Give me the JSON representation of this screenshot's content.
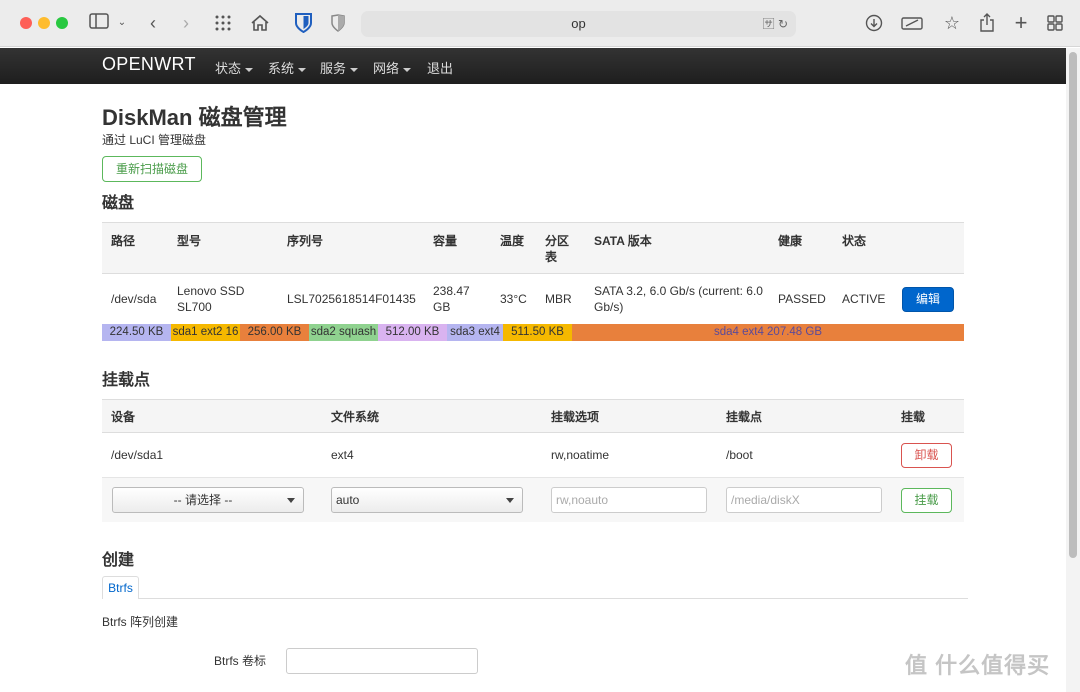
{
  "browser": {
    "address": "op"
  },
  "navbar": {
    "brand": "OPENWRT",
    "items": [
      "状态",
      "系统",
      "服务",
      "网络",
      "退出"
    ]
  },
  "page": {
    "title": "DiskMan 磁盘管理",
    "subtitle": "通过 LuCI 管理磁盘",
    "rescan_label": "重新扫描磁盘"
  },
  "disks": {
    "heading": "磁盘",
    "headers": {
      "path": "路径",
      "model": "型号",
      "serial": "序列号",
      "size": "容量",
      "temp": "温度",
      "ptable": "分区表",
      "sata": "SATA 版本",
      "health": "健康",
      "status": "状态"
    },
    "row": {
      "path": "/dev/sda",
      "model": "Lenovo SSD SL700",
      "serial": "LSL7025618514F01435",
      "size": "238.47 GB",
      "temp": "33°C",
      "ptable": "MBR",
      "sata": "SATA 3.2, 6.0 Gb/s (current: 6.0 Gb/s)",
      "health": "PASSED",
      "status": "ACTIVE",
      "edit_label": "编辑"
    },
    "partitions": [
      {
        "label": "224.50 KB",
        "color": "#b5b5f0"
      },
      {
        "label": "sda1 ext2 16",
        "color": "#f5b800"
      },
      {
        "label": "256.00 KB",
        "color": "#e8803c"
      },
      {
        "label": "sda2 squash",
        "color": "#8fd28f"
      },
      {
        "label": "512.00 KB",
        "color": "#d9b3f0"
      },
      {
        "label": "sda3 ext4",
        "color": "#b5b5f0"
      },
      {
        "label": "511.50 KB",
        "color": "#f5b800"
      },
      {
        "label": "sda4 ext4 207.48 GB",
        "color": "#e8803c"
      }
    ]
  },
  "mounts": {
    "heading": "挂载点",
    "headers": {
      "device": "设备",
      "fs": "文件系统",
      "options": "挂载选项",
      "mountpoint": "挂载点",
      "action": "挂载"
    },
    "row": {
      "device": "/dev/sda1",
      "fs": "ext4",
      "options": "rw,noatime",
      "mountpoint": "/boot",
      "unmount_label": "卸载"
    },
    "new": {
      "device_select": "-- 请选择 --",
      "fs_select": "auto",
      "options_placeholder": "rw,noauto",
      "mountpoint_placeholder": "/media/diskX",
      "mount_label": "挂载"
    }
  },
  "create": {
    "heading": "创建",
    "tab_label": "Btrfs",
    "section_title": "Btrfs 阵列创建",
    "volume_label": "Btrfs 卷标"
  },
  "watermark": "值 什么值得买"
}
